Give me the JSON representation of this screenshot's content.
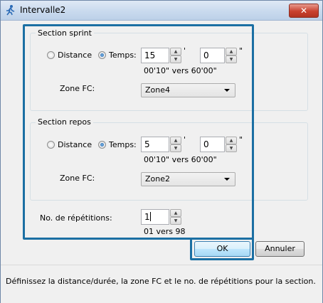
{
  "window": {
    "title": "Intervalle2",
    "close_symbol": "✕"
  },
  "sprint": {
    "group_title": "Section sprint",
    "radio_distance": "Distance",
    "radio_temps": "Temps:",
    "minutes": "15",
    "seconds": "0",
    "minute_mark": "'",
    "second_mark": "\"",
    "range_hint": "00'10\" vers 60'00\"",
    "zone_label": "Zone FC:",
    "zone_value": "Zone4"
  },
  "rest": {
    "group_title": "Section repos",
    "radio_distance": "Distance",
    "radio_temps": "Temps:",
    "minutes": "5",
    "seconds": "0",
    "minute_mark": "'",
    "second_mark": "\"",
    "range_hint": "00'10\" vers 60'00\"",
    "zone_label": "Zone FC:",
    "zone_value": "Zone2"
  },
  "repetitions": {
    "label": "No. de répétitions:",
    "value": "1",
    "range_hint": "01 vers 98"
  },
  "buttons": {
    "ok": "OK",
    "cancel": "Annuler"
  },
  "status": "Définissez la distance/durée, la zone FC et le no. de répétitions pour la section."
}
